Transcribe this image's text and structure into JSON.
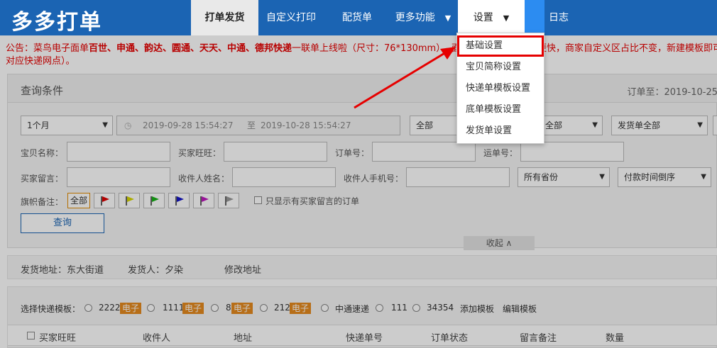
{
  "app": {
    "logo": "多多打单"
  },
  "nav": {
    "items": [
      {
        "label": "打单发货"
      },
      {
        "label": "自定义打印"
      },
      {
        "label": "配货单"
      },
      {
        "label": "更多功能",
        "caret": "▼"
      },
      {
        "label": "设置",
        "caret": "▼"
      },
      {
        "label": "日志"
      }
    ]
  },
  "notice": {
    "prefix": "公告：菜鸟电子面单",
    "carriers": "百世、申通、韵达、圆通、天天、中通、德邦快递",
    "middle": "一联单上线啦（尺寸：76*130mm）- 面",
    "tail": "更快，商家自定义区占比不变，新建模板即可使用（需",
    "line2": "对应快递网点）。"
  },
  "query": {
    "title": "查询条件",
    "order_to": "订单至：2019-10-25",
    "period": "1个月",
    "date_from": "2019-09-28 15:54:27",
    "date_sep": "至",
    "date_to": "2019-10-28 15:54:27",
    "select_all": "全部",
    "select_all2": "全部",
    "ship_all": "发货单全部",
    "labels": {
      "item_name": "宝贝名称：",
      "buyer_id": "买家旺旺：",
      "order_no": "订单号：",
      "waybill_no": "运单号：",
      "buyer_msg": "买家留言：",
      "receiver_name": "收件人姓名：",
      "receiver_phone": "收件人手机号：",
      "flag_note": "旗帜备注："
    },
    "province": "所有省份",
    "sort": "付款时间倒序",
    "flag_all": "全部",
    "only_msg": "只显示有买家留言的订单",
    "query_btn": "查询",
    "collapse": "收起 ∧",
    "flag_colors": [
      "#e00000",
      "#d8d800",
      "#18b418",
      "#1515c8",
      "#c018c0",
      "#999999"
    ]
  },
  "address": {
    "ship_addr": "发货地址：东大街道",
    "sender": "发货人：夕染",
    "edit": "修改地址"
  },
  "templates": {
    "label": "选择快递模板：",
    "items": [
      {
        "name": "2222",
        "tag": "电子"
      },
      {
        "name": "1111",
        "tag": "电子"
      },
      {
        "name": "8",
        "tag": "电子"
      },
      {
        "name": "212",
        "tag": "电子"
      },
      {
        "name": "中通速递",
        "tag": ""
      },
      {
        "name": "111",
        "tag": ""
      },
      {
        "name": "34354",
        "tag": ""
      }
    ],
    "add": "添加模板",
    "edit": "编辑模板"
  },
  "table": {
    "headers": [
      "买家旺旺",
      "收件人",
      "地址",
      "快递单号",
      "订单状态",
      "留言备注",
      "数量"
    ]
  },
  "dropdown": {
    "items": [
      {
        "label": "基础设置"
      },
      {
        "label": "宝贝简称设置"
      },
      {
        "label": "快递单模板设置"
      },
      {
        "label": "底单模板设置"
      },
      {
        "label": "发货单设置"
      }
    ]
  },
  "colors": {
    "brand": "#1b64b3",
    "notice": "#e60000",
    "tag": "#e58a1e"
  }
}
